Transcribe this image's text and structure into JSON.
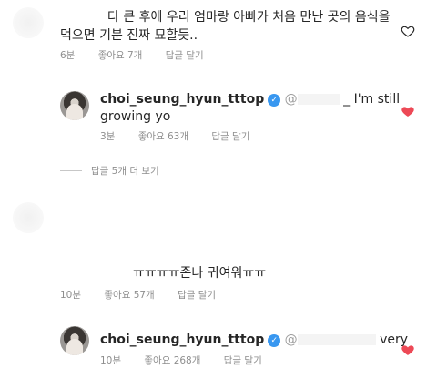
{
  "comments": [
    {
      "text_line1": "다 큰 후에 우리 엄마랑 아빠가 처음 만난 곳의 음식을",
      "text_line2": "먹으면 기분 진짜 묘할듯..",
      "time": "6분",
      "likes": "좋아요 7개",
      "reply": "답글 달기",
      "liked": false
    },
    {
      "username": "choi_seung_hyun_tttop",
      "mention_prefix": "@",
      "text_after_mention": "_ I'm still",
      "text_line2": "growing yo",
      "time": "3분",
      "likes": "좋아요 63개",
      "reply": "답글 달기",
      "liked": true
    },
    {
      "view_replies": "답글 5개 더 보기"
    },
    {
      "text": "ㅠㅠㅠㅠ존나 귀여워ㅠㅠ",
      "time": "10분",
      "likes": "좋아요 57개",
      "reply": "답글 달기",
      "liked": false
    },
    {
      "username": "choi_seung_hyun_tttop",
      "mention_prefix": "@",
      "text_after_mention": "very",
      "time": "10분",
      "likes": "좋아요 268개",
      "reply": "답글 달기",
      "liked": true
    }
  ],
  "icons": {
    "verified": "verified-badge-icon",
    "heart": "heart-icon"
  },
  "colors": {
    "like_red": "#ed4956",
    "verified_blue": "#3897f0",
    "meta_gray": "#8e8e8e"
  }
}
